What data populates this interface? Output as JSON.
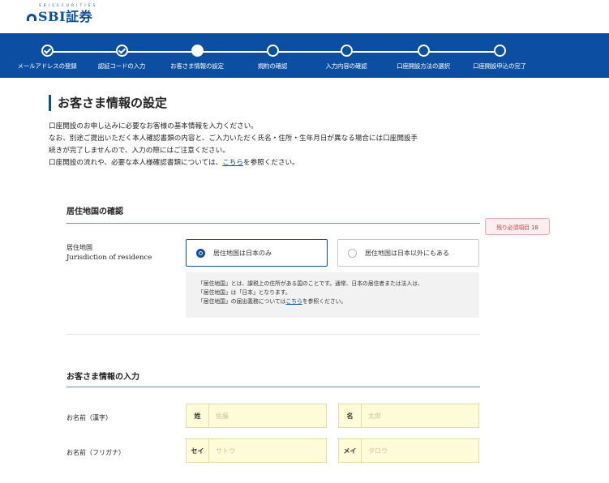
{
  "header": {
    "logo_text": "SBI証券",
    "logo_sub": "S B I S E C U R I T I E S"
  },
  "progress": {
    "steps": [
      {
        "label": "メールアドレスの登録",
        "state": "done"
      },
      {
        "label": "認証コードの入力",
        "state": "done"
      },
      {
        "label": "お客さま情報の設定",
        "state": "current"
      },
      {
        "label": "規約の確認",
        "state": "todo"
      },
      {
        "label": "入力内容の確認",
        "state": "todo"
      },
      {
        "label": "口座開設方法の選択",
        "state": "todo"
      },
      {
        "label": "口座開設申込の完了",
        "state": "todo"
      }
    ]
  },
  "page": {
    "title": "お客さま情報の設定",
    "intro": {
      "line1": "口座開設のお申し込みに必要なお客様の基本情報を入力ください。",
      "line2": "なお、別途ご提出いただく本人確認書類の内容と、ご入力いただく氏名・住所・生年月日が異なる場合には口座開設手",
      "line3": "続きが完了しませんので、入力の際にはご注意ください。",
      "line4_before": "口座開設の流れや、必要な本人様確認書類については、",
      "line4_link": "こちら",
      "line4_after": "を参照ください。"
    }
  },
  "residence_section": {
    "title": "居住地国の確認",
    "badge": "残り必須項目 18",
    "label_ja": "居住地国",
    "label_en": "Jurisdiction of residence",
    "options": [
      {
        "label": "居住地国は日本のみ",
        "selected": true
      },
      {
        "label": "居住地国は日本以外にもある",
        "selected": false
      }
    ],
    "note": {
      "line1": "「居住地国」とは、課税上の住所がある国のことです。通常、日本の居住者または法人は、",
      "line2": "「居住地国」は「日本」となります。",
      "line3_before": "「居住地国」の届出義務については",
      "line3_link": "こちら",
      "line3_after": "を参照ください。"
    }
  },
  "customer_section": {
    "title": "お客さま情報の入力",
    "name_kanji": {
      "label": "お名前（漢字）",
      "last_prefix": "姓",
      "last_placeholder": "佐藤",
      "first_prefix": "名",
      "first_placeholder": "太郎"
    },
    "name_kana": {
      "label": "お名前（フリガナ）",
      "last_prefix": "セイ",
      "last_placeholder": "サトウ",
      "first_prefix": "メイ",
      "first_placeholder": "タロウ"
    }
  }
}
